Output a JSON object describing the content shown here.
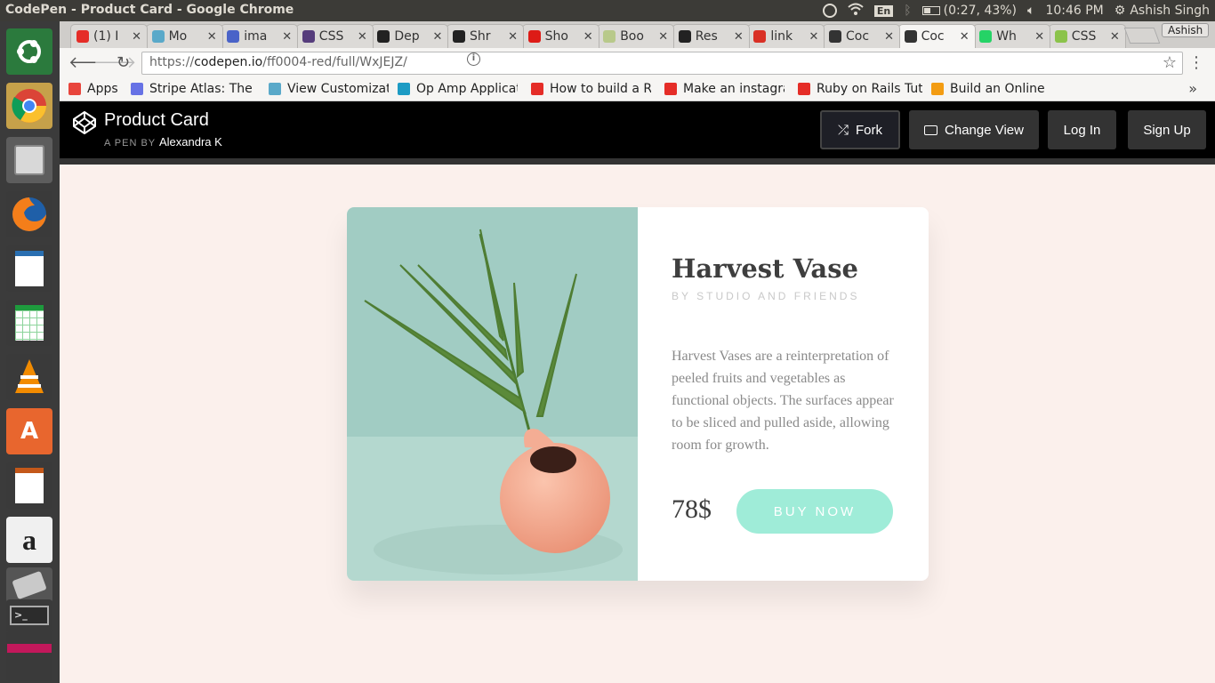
{
  "os": {
    "window_title": "CodePen - Product Card - Google Chrome",
    "tray": {
      "lang": "En",
      "battery": "(0:27, 43%)",
      "time": "10:46 PM",
      "user": "Ashish Singh"
    },
    "launcher": [
      "ubuntu-dash",
      "chrome",
      "files",
      "firefox",
      "libreoffice-impress-doc",
      "libreoffice-calc",
      "vlc",
      "software-center",
      "libreoffice-impress",
      "amazon",
      "settings",
      "terminal",
      "app-stack"
    ]
  },
  "browser": {
    "tabs": [
      {
        "label": "(1) I",
        "icon": "youtube",
        "color": "#e52d27"
      },
      {
        "label": "Mo",
        "icon": "tree",
        "color": "#5aa9c9"
      },
      {
        "label": "ima",
        "icon": "letter-a",
        "color": "#4a63c8"
      },
      {
        "label": "CSS",
        "icon": "bootstrap",
        "color": "#563d7c"
      },
      {
        "label": "Dep",
        "icon": "github",
        "color": "#222222"
      },
      {
        "label": "Shr",
        "icon": "github",
        "color": "#222222"
      },
      {
        "label": "Sho",
        "icon": "angular",
        "color": "#dd1b16"
      },
      {
        "label": "Boo",
        "icon": "css-doc",
        "color": "#b8c98a"
      },
      {
        "label": "Res",
        "icon": "github",
        "color": "#222222"
      },
      {
        "label": "link",
        "icon": "gmail",
        "color": "#d93025"
      },
      {
        "label": "Coc",
        "icon": "codepen",
        "color": "#333333"
      },
      {
        "label": "Coc",
        "icon": "codepen",
        "color": "#333333",
        "active": true
      },
      {
        "label": "Wh",
        "icon": "whatsapp",
        "color": "#25d366"
      },
      {
        "label": "CSS",
        "icon": "css-tricks",
        "color": "#8bc34a"
      }
    ],
    "profile": "Ashish",
    "url_prefix": "https://",
    "url_host": "codepen.io",
    "url_path": "/ff0004-red/full/WxJEJZ/",
    "bookmarks": [
      {
        "label": "Apps",
        "icon": "apps-grid",
        "color": "#e8453c"
      },
      {
        "label": "Stripe Atlas: The",
        "icon": "stripe",
        "color": "#6772e5"
      },
      {
        "label": "View Customizat",
        "icon": "tree",
        "color": "#5aa9c9"
      },
      {
        "label": "Op Amp Applicat",
        "icon": "electronics",
        "color": "#1d9bc4"
      },
      {
        "label": "How to build a R",
        "icon": "youtube",
        "color": "#e52d27"
      },
      {
        "label": "Make an instagra",
        "icon": "youtube",
        "color": "#e52d27"
      },
      {
        "label": "Ruby on Rails Tut",
        "icon": "youtube",
        "color": "#e52d27"
      },
      {
        "label": "Build an Online S",
        "icon": "sitepoint",
        "color": "#f39c12"
      }
    ],
    "more": "»"
  },
  "codepen": {
    "title": "Product Card",
    "by_label": "A PEN BY",
    "author": "Alexandra K",
    "fork": "Fork",
    "change_view": "Change View",
    "login": "Log In",
    "signup": "Sign Up"
  },
  "product": {
    "name": "Harvest Vase",
    "by": "BY STUDIO AND FRIENDS",
    "description": "Harvest Vases are a reinterpretation of peeled fruits and vegetables as functional objects. The surfaces appear to be sliced and pulled aside, allowing room for growth.",
    "price": "78$",
    "buy": "BUY NOW",
    "colors": {
      "accent": "#9fecd8",
      "page_bg": "#fbf0ec",
      "image_wall": "#a1ccc3",
      "image_table": "#b4d8cf",
      "vase": "#f5a890"
    }
  }
}
